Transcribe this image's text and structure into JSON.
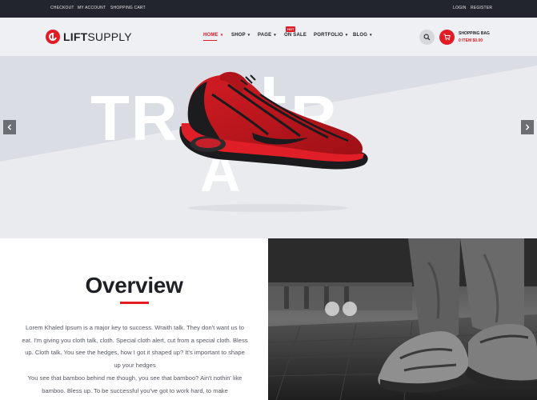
{
  "topbar": {
    "left_links": [
      "CHECKOUT",
      "MY ACCOUNT",
      "SHOPPING CART"
    ],
    "right_links": [
      "LOGIN",
      "REGISTER"
    ]
  },
  "header": {
    "logo_bold": "LIFT",
    "logo_light": "SUPPLY",
    "nav": [
      {
        "label": "HOME",
        "caret": "▾"
      },
      {
        "label": "SHOP",
        "caret": "▾"
      },
      {
        "label": "PAGE",
        "caret": "▾"
      },
      {
        "label": "ON SALE",
        "caret": ""
      },
      {
        "label": "PORTFOLIO",
        "caret": "▾"
      },
      {
        "label": "BLOG",
        "caret": "▾"
      }
    ],
    "hot_badge": "HOT",
    "bag_title": "SHOPPING BAG",
    "bag_total": "0 ITEM $0.00"
  },
  "hero": {
    "word_top": "TR NER",
    "letter_i": "I",
    "word_bottom": "A",
    "prev_icon": "chevron-left-icon",
    "next_icon": "chevron-right-icon"
  },
  "overview": {
    "title": "Overview",
    "paragraph1": "Lorem Khaled Ipsum is a major key to success. Wraith talk. They don't want us to eat. I'm giving you cloth talk, cloth. Special cloth alert, cut from a special cloth. Bless up. Cloth talk. You see the hedges, how I got it shaped up? It's important to shape up your hedges",
    "paragraph2": "You see that bamboo behind me though, you see that bamboo? Ain't nothin' like bamboo. Bless up. To be successful you've got to work hard, to make"
  },
  "colors": {
    "accent": "#e21b24",
    "dark": "#23252e",
    "text": "#1f2026"
  }
}
